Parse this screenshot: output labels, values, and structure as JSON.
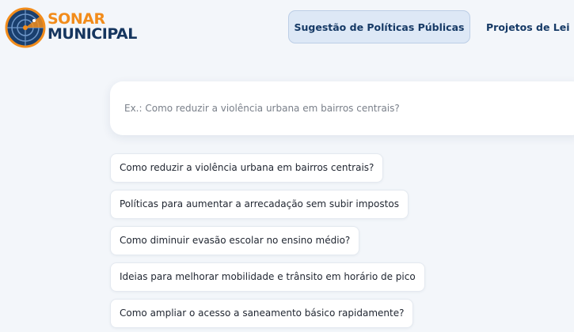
{
  "brand": {
    "line1": "SONAR",
    "line2": "MUNICIPAL",
    "logo_icon": "radar-icon",
    "colors": {
      "orange": "#f28c1b",
      "navy": "#16365f"
    }
  },
  "nav": {
    "active_tab": "Sugestão de Políticas Públicas",
    "second_tab": "Projetos de Lei"
  },
  "search": {
    "value": "",
    "placeholder": "Ex.: Como reduzir a violência urbana em bairros centrais?"
  },
  "suggestions": [
    "Como reduzir a violência urbana em bairros centrais?",
    "Políticas para aumentar a arrecadação sem subir impostos",
    "Como diminuir evasão escolar no ensino médio?",
    "Ideias para melhorar mobilidade e trânsito em horário de pico",
    "Como ampliar o acesso a saneamento básico rapidamente?"
  ]
}
